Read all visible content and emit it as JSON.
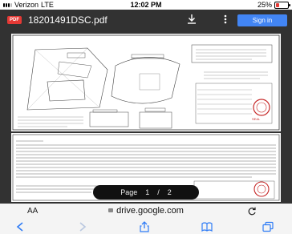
{
  "status_bar": {
    "carrier": "Verizon",
    "network": "LTE",
    "time": "12:02 PM",
    "battery_text": "25%",
    "battery_level": 0.25,
    "battery_color": "#e53935"
  },
  "header": {
    "badge": "PDF",
    "filename": "18201491DSC.pdf",
    "download_icon": "download-icon",
    "more_icon": "more-vert-icon",
    "sign_in": "Sign in"
  },
  "viewer": {
    "page_label": "Page",
    "current_page": "1",
    "separator": "/",
    "total_pages": "2"
  },
  "address_bar": {
    "aa": "AA",
    "url": "drive.google.com",
    "reload_icon": "reload-icon"
  },
  "toolbar": {
    "icons": [
      "back-icon",
      "forward-icon",
      "share-icon",
      "bookmarks-icon",
      "tabs-icon"
    ]
  },
  "colors": {
    "accent": "#4285f4",
    "pdf_badge": "#e53935",
    "safari_blue": "#2f7cf6"
  }
}
